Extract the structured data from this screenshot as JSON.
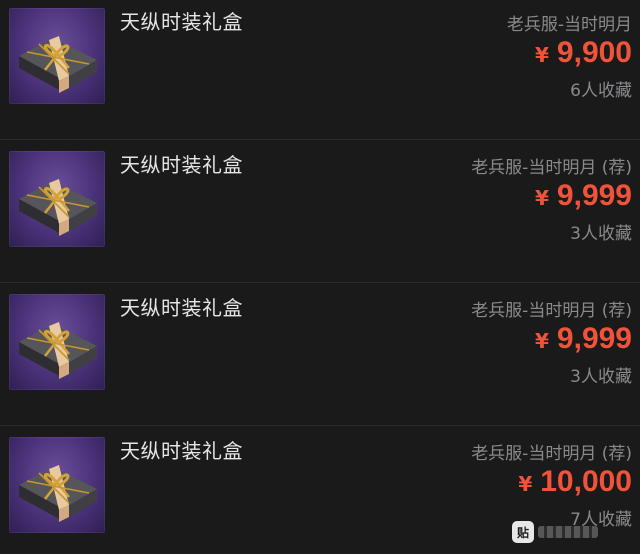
{
  "items": [
    {
      "name": "天纵时装礼盒",
      "server": "老兵服-当时明月",
      "price_symbol": "¥",
      "price": "9,900",
      "favorites": "6人收藏"
    },
    {
      "name": "天纵时装礼盒",
      "server": "老兵服-当时明月 (荐)",
      "price_symbol": "¥",
      "price": "9,999",
      "favorites": "3人收藏"
    },
    {
      "name": "天纵时装礼盒",
      "server": "老兵服-当时明月 (荐)",
      "price_symbol": "¥",
      "price": "9,999",
      "favorites": "3人收藏"
    },
    {
      "name": "天纵时装礼盒",
      "server": "老兵服-当时明月 (荐)",
      "price_symbol": "¥",
      "price": "10,000",
      "favorites": "7人收藏"
    }
  ],
  "colors": {
    "background": "#1a1a1b",
    "price": "#f0533a",
    "muted_text": "#8a8a8c",
    "title_text": "#e6e6e6",
    "thumb_purple": "#4a3279",
    "gift_box": "#3a3a3e",
    "ribbon_gold": "#d4a23a"
  },
  "icons": {
    "thumbnail": "gift-box-icon",
    "watermark": "watermark-icon"
  },
  "watermark": {
    "label": "贴"
  }
}
